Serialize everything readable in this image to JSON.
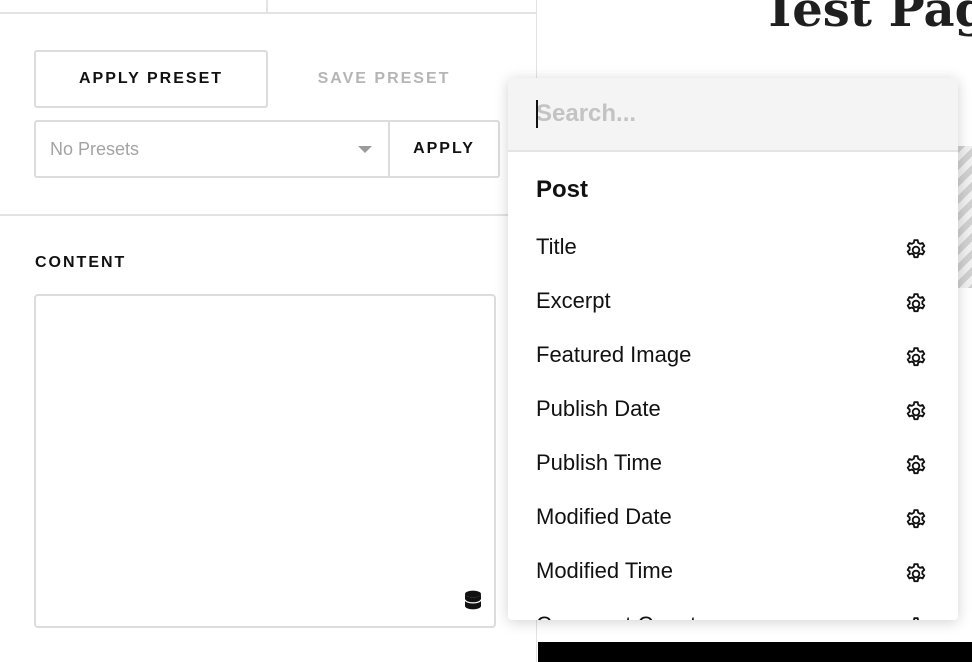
{
  "preset_panel": {
    "apply_preset_label": "APPLY PRESET",
    "save_preset_label": "SAVE PRESET",
    "preset_select_value": "No Presets",
    "apply_label": "APPLY"
  },
  "content_section": {
    "label": "CONTENT",
    "icon": "database-icon"
  },
  "page": {
    "title": "Test Pag"
  },
  "dropdown": {
    "search_placeholder": "Search...",
    "group_label": "Post",
    "items": [
      {
        "label": "Title",
        "icon": "gear-icon"
      },
      {
        "label": "Excerpt",
        "icon": "gear-icon"
      },
      {
        "label": "Featured Image",
        "icon": "gear-icon"
      },
      {
        "label": "Publish Date",
        "icon": "gear-icon"
      },
      {
        "label": "Publish Time",
        "icon": "gear-icon"
      },
      {
        "label": "Modified Date",
        "icon": "gear-icon"
      },
      {
        "label": "Modified Time",
        "icon": "gear-icon"
      },
      {
        "label": "Comment Count",
        "icon": "gear-icon"
      }
    ]
  }
}
